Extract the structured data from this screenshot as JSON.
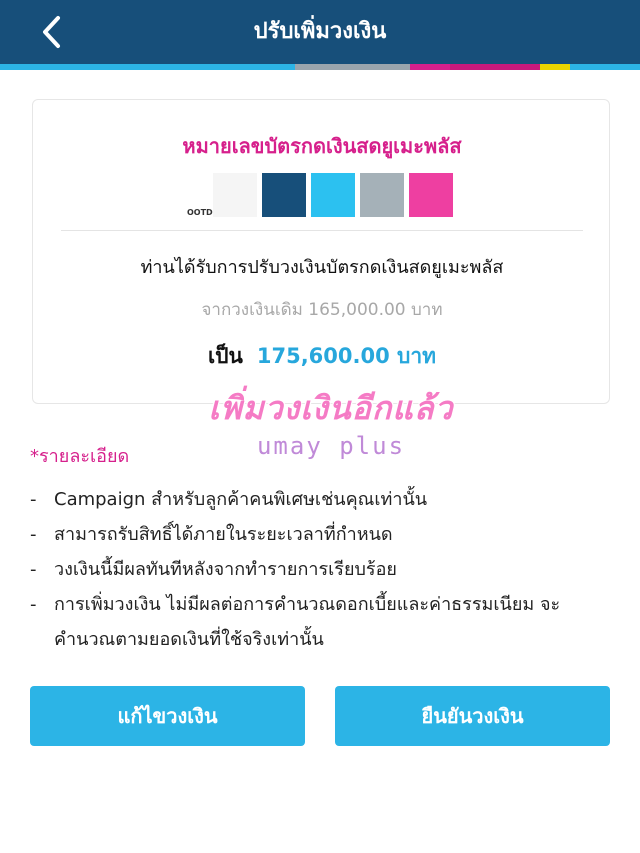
{
  "header": {
    "title": "ปรับเพิ่มวงเงิน",
    "back_icon": "chevron-left-icon",
    "background": "#174f7a"
  },
  "stripes": [
    {
      "color": "#2cb4e6"
    },
    {
      "color": "#2cb4e6"
    },
    {
      "color": "#2cb4e6"
    },
    {
      "color": "#9aa5ad"
    },
    {
      "color": "#d6208c"
    },
    {
      "color": "#c7197c"
    },
    {
      "color": "#e9d400"
    },
    {
      "color": "#2cb4e6"
    }
  ],
  "card": {
    "title": "หมายเลขบัตรกดเงินสดยูเมะพลัส",
    "swatch_tag": "OOTD",
    "swatches": [
      {
        "color": "#f5f5f5"
      },
      {
        "color": "#174f7a"
      },
      {
        "color": "#2cc1f0"
      },
      {
        "color": "#a5b1b8"
      },
      {
        "color": "#ee3fa1"
      }
    ],
    "message": "ท่านได้รับการปรับวงเงินบัตรกดเงินสดยูเมะพลัส",
    "from_text": "จากวงเงินเดิม 165,000.00 บาท",
    "to_label": "เป็น",
    "to_amount": "175,600.00 บาท"
  },
  "overlay": {
    "title": "เพิ่มวงเงินอีกแล้ว",
    "subtitle": "umay plus"
  },
  "details": {
    "label": "*รายละเอียด",
    "items": [
      "Campaign สำหรับลูกค้าคนพิเศษเช่นคุณเท่านั้น",
      "สามารถรับสิทธิ์ได้ภายในระยะเวลาที่กำหนด",
      "วงเงินนี้มีผลทันทีหลังจากทำรายการเรียบร้อย",
      "การเพิ่มวงเงิน ไม่มีผลต่อการคำนวณดอกเบี้ยและค่าธรรมเนียม จะ",
      "คำนวณตามยอดเงินที่ใช้จริงเท่านั้น"
    ]
  },
  "buttons": {
    "edit_label": "แก้ไขวงเงิน",
    "confirm_label": "ยืนยันวงเงิน",
    "color": "#2cb4e6"
  }
}
